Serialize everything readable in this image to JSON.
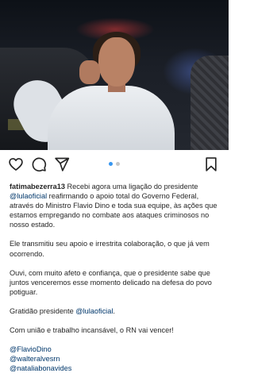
{
  "photo": {
    "description_icon": "post-photo"
  },
  "actions": {
    "like_icon": "heart-icon",
    "comment_icon": "comment-icon",
    "share_icon": "send-icon",
    "save_icon": "bookmark-icon"
  },
  "carousel": {
    "count": 2,
    "active_index": 0,
    "active_color": "#3897f0"
  },
  "caption": {
    "username": "fatimabezerra13",
    "p1_a": " Recebi agora uma ligação do presidente ",
    "p1_mention": "@lulaoficial",
    "p1_b": " reafirmando o apoio total do Governo Federal, através do Ministro Flavio Dino e toda sua equipe, às ações que estamos empregando no combate aos ataques criminosos no nosso estado.",
    "p2": "Ele transmitiu seu apoio e irrestrita colaboração, o que já vem ocorrendo.",
    "p3": "Ouvi, com muito afeto e confiança, que o presidente sabe que juntos venceremos esse momento delicado na defesa do povo potiguar.",
    "p4_a": "Gratidão presidente ",
    "p4_mention": "@lulaoficial",
    "p4_b": ".",
    "p5": "Com união e trabalho incansável, o RN vai vencer!",
    "tags": [
      "@FlavioDino",
      "@walteralvesrn",
      "@nataliabonavides"
    ]
  }
}
